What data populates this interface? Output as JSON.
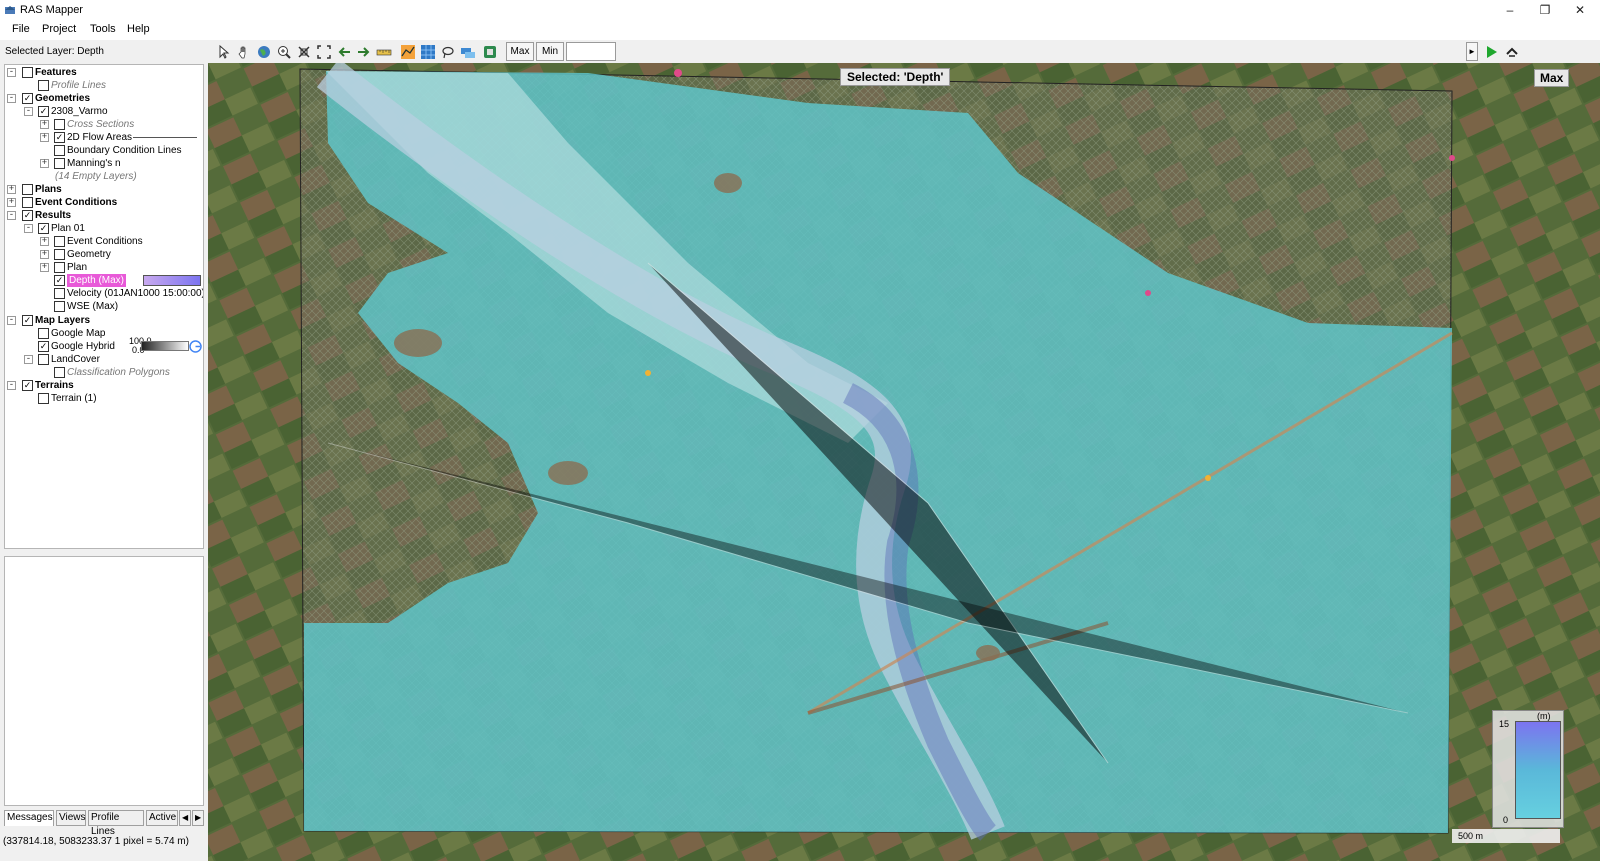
{
  "window": {
    "title": "RAS Mapper"
  },
  "menu": [
    "File",
    "Project",
    "Tools",
    "Help"
  ],
  "toolbar": {
    "selected_layer": "Selected Layer: Depth",
    "max_label": "Max",
    "min_label": "Min"
  },
  "tree": {
    "features": "Features",
    "profile_lines": "Profile Lines",
    "geometries": "Geometries",
    "geom_2308": "2308_Varmo",
    "cross_sections": "Cross Sections",
    "flow_areas": "2D Flow Areas",
    "bc_lines": "Boundary Condition Lines",
    "mannings": "Manning's n",
    "empty_layers": "(14 Empty Layers)",
    "plans": "Plans",
    "event_conditions": "Event Conditions",
    "results": "Results",
    "plan01": "Plan 01",
    "res_event": "Event Conditions",
    "res_geometry": "Geometry",
    "res_plan": "Plan",
    "depth_max": "Depth (Max)",
    "velocity": "Velocity (01JAN1000 15:00:00)",
    "wse_max": "WSE (Max)",
    "map_layers": "Map Layers",
    "google_map": "Google Map",
    "google_hybrid": "Google Hybrid",
    "opacity_value": "100.0",
    "opacity_min": "0.0",
    "landcover": "LandCover",
    "class_polys": "Classification Polygons",
    "terrains": "Terrains",
    "terrain1": "Terrain (1)"
  },
  "tabs": [
    "Messages",
    "Views",
    "Profile Lines",
    "Active"
  ],
  "status": "(337814.18, 5083233.37  1 pixel = 5.74 m)",
  "map": {
    "selected_label": "Selected: 'Depth'",
    "max_label": "Max",
    "legend_unit": "(m)",
    "legend_max": "15",
    "legend_min": "0",
    "scale": "500 m",
    "colors": {
      "flood": "#5fc4c8",
      "river": "#b8cfe0",
      "field_green": "#4f6a35",
      "field_brown": "#7a6447"
    }
  }
}
